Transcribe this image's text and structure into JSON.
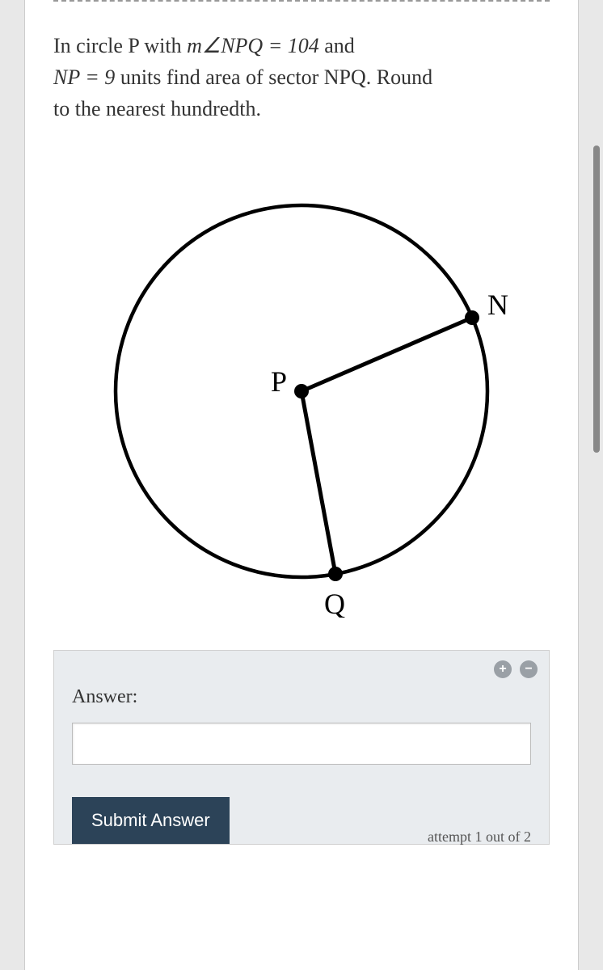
{
  "problem": {
    "line1_pre": "In circle P with ",
    "angle_expr": "m∠NPQ = 104",
    "line1_post": " and",
    "line2_pre": "NP = 9",
    "line2_post": " units find area of sector NPQ. Round",
    "line3": "to the nearest hundredth."
  },
  "diagram": {
    "labels": {
      "P": "P",
      "N": "N",
      "Q": "Q"
    }
  },
  "answer": {
    "label": "Answer:",
    "value": ""
  },
  "submit_label": "Submit Answer",
  "attempt_text": "attempt 1 out of 2",
  "zoom": {
    "plus": "+",
    "minus": "−"
  }
}
